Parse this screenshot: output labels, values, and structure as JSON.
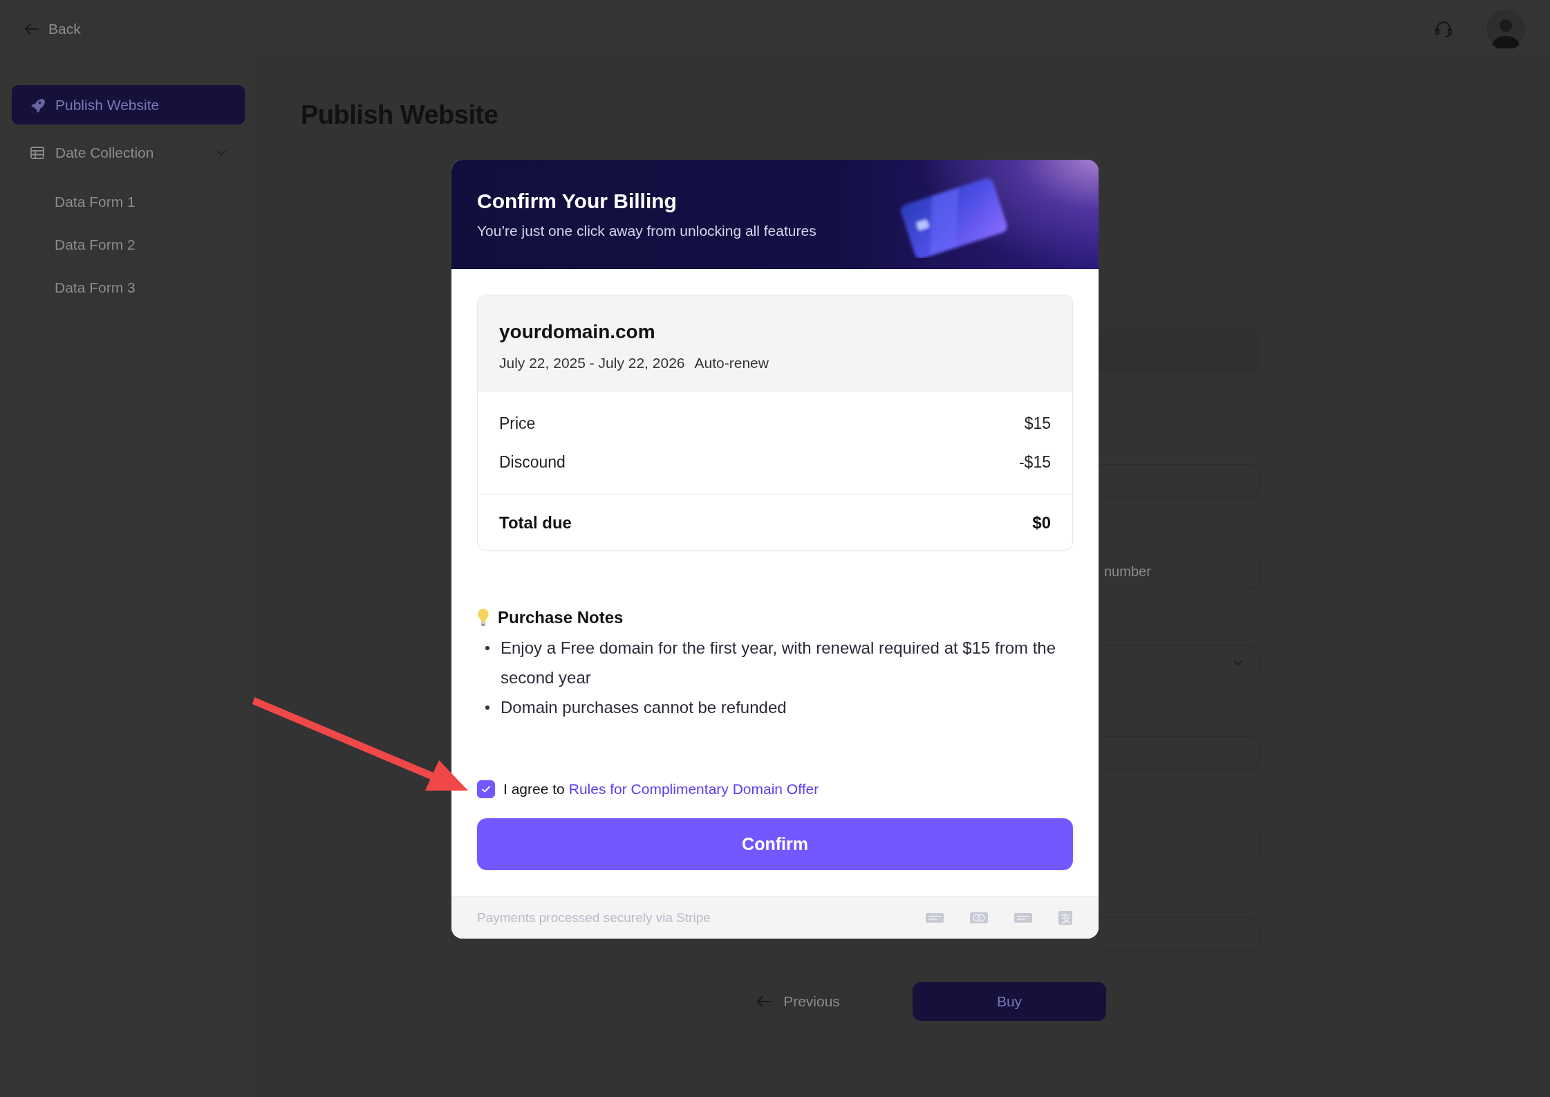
{
  "top_bar": {
    "back": {
      "label": "Back"
    }
  },
  "sidebar": {
    "items": [
      {
        "label": "Publish Website",
        "kind": "page",
        "selected": true
      },
      {
        "label": "Date Collection",
        "kind": "group",
        "selected": false,
        "expanded": true,
        "children": [
          {
            "label": "Data Form 1"
          },
          {
            "label": "Data Form 2"
          },
          {
            "label": "Data Form 3"
          }
        ]
      }
    ]
  },
  "page": {
    "title": "Publish Website",
    "form": {
      "fields": [
        {
          "kind": "filled"
        },
        {
          "kind": "text"
        },
        {
          "kind": "text",
          "placeholder": "number"
        },
        {
          "kind": "select"
        },
        {
          "kind": "text"
        },
        {
          "kind": "text"
        },
        {
          "kind": "text"
        }
      ]
    },
    "buttons": [
      {
        "label": "Previous",
        "kind": "secondary"
      },
      {
        "label": "Buy",
        "kind": "primary"
      }
    ]
  },
  "dialog": {
    "title": "Confirm Your Billing",
    "subtitle": "You’re just one click away from unlocking all features",
    "order": {
      "domain": "yourdomain.com",
      "period": "July 22, 2025 - July 22, 2026",
      "renewal": "Auto-renew",
      "lines": [
        {
          "label": "Price",
          "amount": "$15"
        },
        {
          "label": "Discound",
          "amount": "-$15"
        }
      ],
      "total": {
        "label": "Total due",
        "amount": "$0"
      }
    },
    "notes": {
      "title": "Purchase Notes",
      "items": [
        "Enjoy a Free domain for the first year, with renewal required at $15 from the second year",
        "Domain purchases cannot be refunded"
      ]
    },
    "agreement": {
      "checked": true,
      "text": "I agree to",
      "link": "Rules for Complimentary Domain Offer"
    },
    "confirm": {
      "label": "Confirm"
    },
    "footer": {
      "text": "Payments processed securely via Stripe",
      "methods": [
        {
          "kind": "card"
        },
        {
          "kind": "circles"
        },
        {
          "kind": "card"
        },
        {
          "kind": "logo"
        }
      ]
    }
  },
  "annotation": {
    "kind": "arrow"
  }
}
